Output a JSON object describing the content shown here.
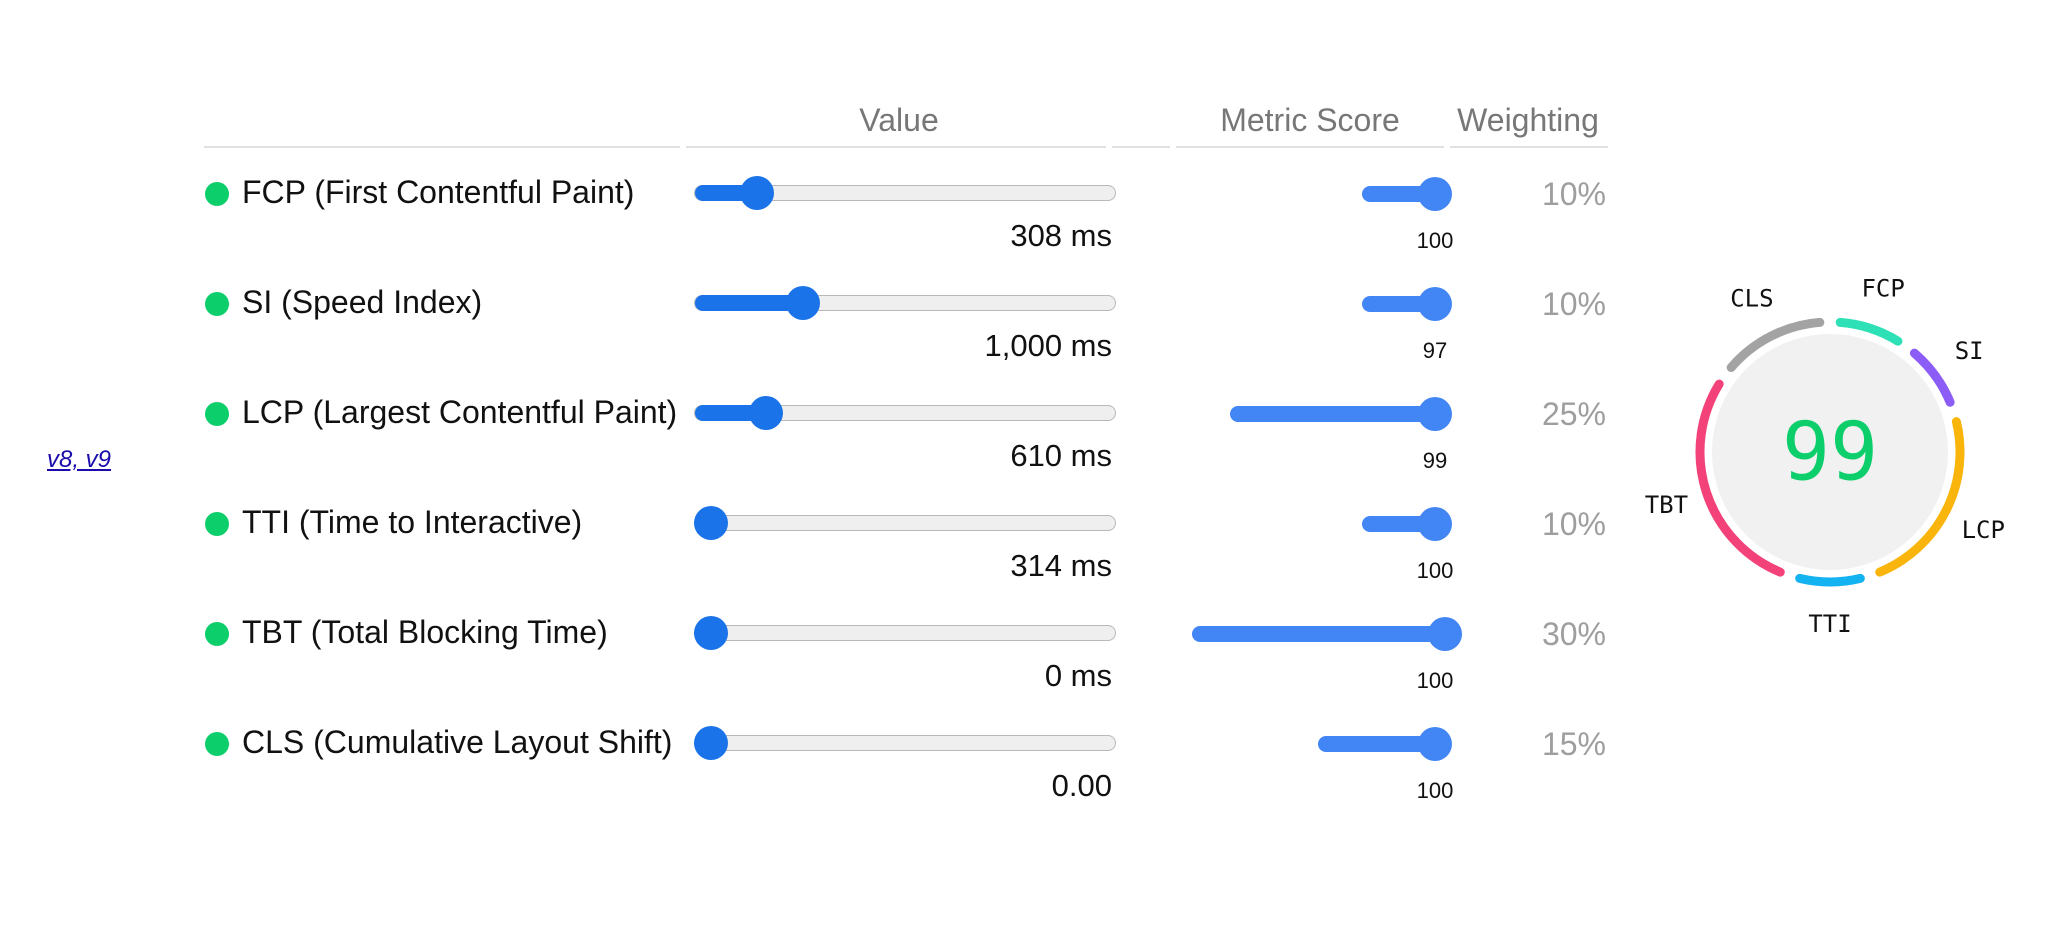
{
  "version_link": "v8, v9",
  "headers": {
    "value": "Value",
    "metric_score": "Metric Score",
    "weighting": "Weighting"
  },
  "status_color": "#0cce6b",
  "metrics": [
    {
      "name": "FCP (First Contentful Paint)",
      "value": "308 ms",
      "slider_fraction": 0.11,
      "score": "100",
      "score_fraction": 1.0,
      "weighting": "10%",
      "score_bar_color": "#4285f4"
    },
    {
      "name": "SI (Speed Index)",
      "value": "1,000 ms",
      "slider_fraction": 0.22,
      "score": "97",
      "score_fraction": 0.97,
      "weighting": "10%",
      "score_bar_color": "#4285f4"
    },
    {
      "name": "LCP (Largest Contentful Paint)",
      "value": "610 ms",
      "slider_fraction": 0.13,
      "score": "99",
      "score_fraction": 0.99,
      "weighting": "25%",
      "score_bar_color": "#4285f4"
    },
    {
      "name": "TTI (Time to Interactive)",
      "value": "314 ms",
      "slider_fraction": 0.0,
      "score": "100",
      "score_fraction": 1.0,
      "weighting": "10%",
      "score_bar_color": "#4285f4"
    },
    {
      "name": "TBT (Total Blocking Time)",
      "value": "0 ms",
      "slider_fraction": 0.0,
      "score": "100",
      "score_fraction": 1.0,
      "weighting": "30%",
      "score_bar_color": "#4285f4"
    },
    {
      "name": "CLS (Cumulative Layout Shift)",
      "value": "0.00",
      "slider_fraction": 0.0,
      "score": "100",
      "score_fraction": 1.0,
      "weighting": "15%",
      "score_bar_color": "#4285f4"
    }
  ],
  "gauge": {
    "score": "99",
    "score_color": "#0cce6b",
    "segments": [
      {
        "label": "FCP",
        "color": "#2ee0b6",
        "weight": 10
      },
      {
        "label": "SI",
        "color": "#8b5cf6",
        "weight": 10
      },
      {
        "label": "LCP",
        "color": "#f9b50c",
        "weight": 25
      },
      {
        "label": "TTI",
        "color": "#13b2f0",
        "weight": 10
      },
      {
        "label": "TBT",
        "color": "#f3427a",
        "weight": 30
      },
      {
        "label": "CLS",
        "color": "#a3a3a3",
        "weight": 15
      }
    ]
  }
}
